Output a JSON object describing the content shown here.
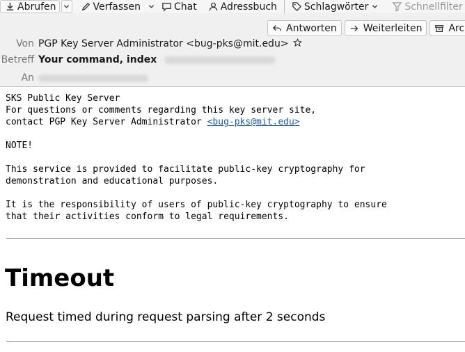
{
  "toolbar": {
    "get_messages": "Abrufen",
    "compose": "Verfassen",
    "chat": "Chat",
    "address_book": "Adressbuch",
    "tags": "Schlagwörter",
    "quick_filter": "Schnellfilter"
  },
  "actions": {
    "reply": "Antworten",
    "forward": "Weiterleiten",
    "archive": "Archi"
  },
  "header": {
    "from_label": "Von",
    "from_value": "PGP Key Server Administrator <bug-pks@mit.edu>",
    "subject_label": "Betreff",
    "subject_value": "Your command, index",
    "to_label": "An"
  },
  "body": {
    "intro_line1": "SKS Public Key Server",
    "intro_line2": "For questions or comments regarding this key server site,",
    "intro_line3_prefix": "contact PGP Key Server Administrator ",
    "contact_link": "<bug-pks@mit.edu>",
    "note": "NOTE!",
    "para1_line1": "This service is provided to facilitate public-key cryptography for",
    "para1_line2": "demonstration and educational purposes.",
    "para2_line1": "It is the responsibility of users of public-key cryptography to ensure",
    "para2_line2": "that their activities conform to legal requirements.",
    "heading": "Timeout",
    "message": "Request timed during request parsing after 2 seconds"
  },
  "icons": {
    "get_messages": "download-icon",
    "compose": "pencil-icon",
    "chat": "chat-bubble-icon",
    "address_book": "contacts-icon",
    "tags": "tag-icon",
    "quick_filter": "filter-icon",
    "reply": "reply-icon",
    "forward": "forward-icon",
    "archive": "archive-icon",
    "star": "star-icon"
  },
  "colors": {
    "link": "#1a5fb4",
    "header_bg": "#f0f0f0",
    "toolbar_bg": "#f6f6f6"
  }
}
